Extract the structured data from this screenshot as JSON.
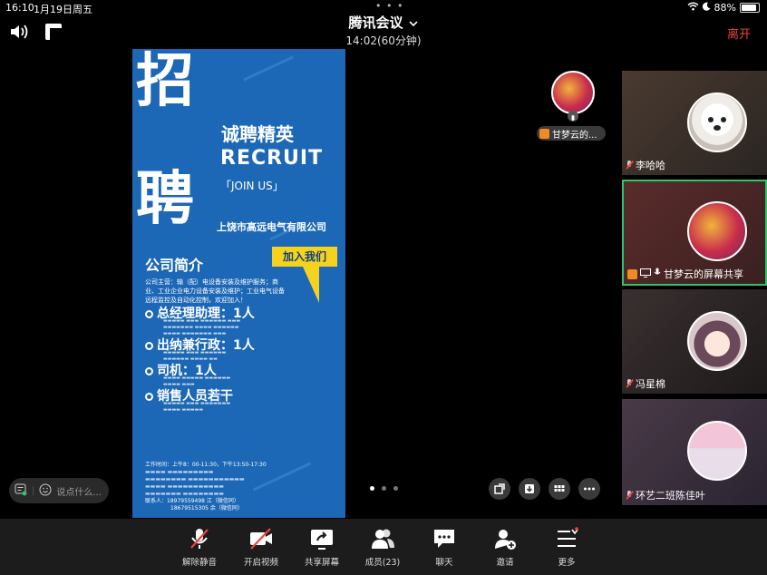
{
  "status_bar": {
    "time": "16:10",
    "date": "1月19日周五",
    "battery": "88%",
    "battery_level": 0.88
  },
  "header": {
    "title": "腾讯会议",
    "timer": "14:02(60分钟)",
    "leave": "离开"
  },
  "poster": {
    "big1": "招",
    "big2": "聘",
    "slogan": "诚聘精英",
    "recruit": "RECRUIT",
    "joinus": "「JOIN US」",
    "company": "上饶市高远电气有限公司",
    "intro_title": "公司简介",
    "join_btn": "加入我们",
    "intro": "公司主营：输（配）电设备安装及维护服务；商业、工业企业电力设备安装及维护；工业电气设备远程监控及自动化控制，欢迎加入！",
    "positions": [
      {
        "title": "总经理助理：1人"
      },
      {
        "title": "出纳兼行政：1人"
      },
      {
        "title": "司机：1人"
      },
      {
        "title": "销售人员若干"
      }
    ],
    "footer": [
      "工作时间：上午8：00-11:30，下午13:50-17:30",
      "联系人：18979559498 江（微信同）",
      "18679515305 余（微信同）"
    ]
  },
  "mini": {
    "label": "甘梦云的..."
  },
  "tiles": [
    {
      "name": "李哈哈",
      "avatar": "dog"
    },
    {
      "name": "甘梦云的屏幕共享",
      "avatar": "flowers"
    },
    {
      "name": "冯星棉",
      "avatar": "girl-anime"
    },
    {
      "name": "环艺二班陈佳叶",
      "avatar": "girl-photo"
    }
  ],
  "chat": {
    "placeholder": "说点什么..."
  },
  "toolbar": [
    {
      "label": "解除静音",
      "icon": "mic-muted-icon"
    },
    {
      "label": "开启视频",
      "icon": "camera-off-icon"
    },
    {
      "label": "共享屏幕",
      "icon": "share-screen-icon"
    },
    {
      "label": "成员(23)",
      "icon": "members-icon"
    },
    {
      "label": "聊天",
      "icon": "chat-icon"
    },
    {
      "label": "邀请",
      "icon": "invite-icon"
    },
    {
      "label": "更多",
      "icon": "more-icon"
    }
  ],
  "colors": {
    "accent_green": "#2ec46d",
    "leave_red": "#e8453c",
    "poster_blue": "#1c68b6",
    "join_yellow": "#f6d21e"
  }
}
